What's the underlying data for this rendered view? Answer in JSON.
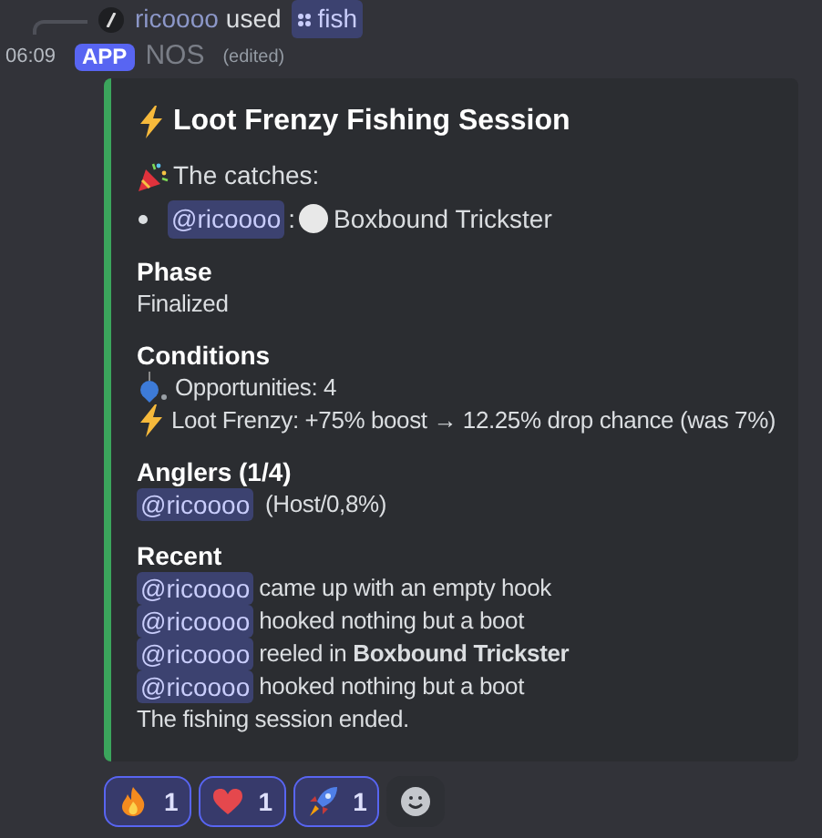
{
  "reply": {
    "user": "ricoooo",
    "text": "used",
    "command": "fish"
  },
  "message": {
    "time": "06:09",
    "badge": "APP",
    "author": "NOS",
    "edited": "(edited)"
  },
  "embed": {
    "color": "#3ba55c",
    "title": "Loot Frenzy Fishing Session",
    "catches_heading": "The catches:",
    "catches": [
      {
        "mention": "@ricoooo",
        "separator": ":",
        "item": "Boxbound Trickster"
      }
    ],
    "fields": [
      {
        "name": "Phase",
        "lines": [
          {
            "text": "Finalized"
          }
        ]
      },
      {
        "name": "Conditions",
        "lines": [
          {
            "kind": "bobber",
            "text": "Opportunities: 4"
          },
          {
            "kind": "bolt",
            "text": "Loot Frenzy: +75% boost → 12.25% drop chance (was 7%)"
          }
        ]
      },
      {
        "name": "Anglers (1/4)",
        "lines": [
          {
            "mention": "@ricoooo",
            "text": " (Host/0,8%)"
          }
        ]
      },
      {
        "name": "Recent",
        "lines": [
          {
            "mention": "@ricoooo",
            "text": "came up with an empty hook"
          },
          {
            "mention": "@ricoooo",
            "text": "hooked nothing but a boot"
          },
          {
            "mention": "@ricoooo",
            "text": "reeled in **Boxbound Trickster**"
          },
          {
            "mention": "@ricoooo",
            "text": "hooked nothing but a boot"
          },
          {
            "text": "The fishing session ended."
          }
        ]
      }
    ]
  },
  "reactions": [
    {
      "kind": "fire",
      "count": "1",
      "selected": true
    },
    {
      "kind": "heart",
      "count": "1",
      "selected": true
    },
    {
      "kind": "rocket",
      "count": "1",
      "selected": true
    }
  ]
}
